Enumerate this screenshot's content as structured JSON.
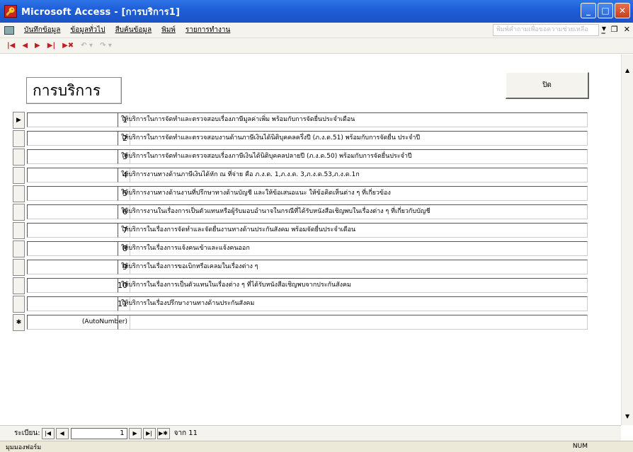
{
  "window": {
    "title": "Microsoft Access - [การบริการ1]",
    "app_icon": "access-key-icon"
  },
  "menu": {
    "items": [
      "บันทึกข้อมูล",
      "ข้อมูลทั่วไป",
      "สืบค้นข้อมูล",
      "พิมพ์",
      "รายการทำงาน"
    ],
    "help_placeholder": "พิมพ์คำถามเพื่อขอความช่วยเหลือ"
  },
  "toolbar": {
    "buttons": [
      "first-record",
      "previous-record",
      "next-record",
      "last-record",
      "delete-record",
      "undo",
      "redo"
    ],
    "glyphs": [
      "|◀",
      "◀",
      "▶",
      "▶|",
      "▶✖",
      "↶ ▾",
      "↷ ▾"
    ]
  },
  "form": {
    "title": "การบริการ",
    "close_button": "ปิด",
    "records": [
      {
        "id": "1",
        "description": "ให้บริการในการจัดทำและตรวจสอบเรื่องภาษีมูลค่าเพิ่ม พร้อมกับการจัดยื่นประจำเดือน"
      },
      {
        "id": "2",
        "description": "ให้บริการในการจัดทำและตรวจสอบงานด้านภาษีเงินได้นิติบุคคลครึ่งปี (ภ.ง.ด.51) พร้อมกับการจัดยื่น ประจำปี"
      },
      {
        "id": "3",
        "description": "ให้บริการในการจัดทำและตรวจสอบเรื่องภาษีเงินได้นิติบุคคลปลายปี (ภ.ง.ด.50) พร้อมกับการจัดยื่นประจำปี"
      },
      {
        "id": "4",
        "description": "ให้บริการงานทางด้านภาษีเงินได้หัก ณ ที่จ่าย คือ ภ.ง.ด. 1,ภ.ง.ด. 3,ภ.ง.ด.53,ภ.ง.ด.1ก"
      },
      {
        "id": "5",
        "description": "ให้บริการงานทางด้านงานที่ปรึกษาทางด้านบัญชี และให้ข้อเสนอแนะ ให้ข้อคิดเห็นต่าง ๆ ที่เกี่ยวข้อง"
      },
      {
        "id": "6",
        "description": "ให้บริการงานในเรื่องการเป็นตัวแทนหรือผู้รับมอบอำนาจในกรณีที่ได้รับหนังสือเชิญพบในเรื่องต่าง ๆ ที่เกี่ยวกับบัญชี"
      },
      {
        "id": "7",
        "description": "ให้บริการในเรื่องการจัดทำและจัดยื่นงานทางด้านประกันสังคม พร้อมจัดยื่นประจำเดือน"
      },
      {
        "id": "8",
        "description": "ให้บริการในเรื่องการแจ้งคนเข้าและแจ้งคนออก"
      },
      {
        "id": "9",
        "description": "ให้บริการในเรื่องการขอเบิกหรือเคลมในเรื่องต่าง ๆ"
      },
      {
        "id": "10",
        "description": "ให้บริการในเรื่องการเป็นตัวแทนในเรื่องต่าง ๆ ที่ได้รับหนังสือเชิญพบจากประกันสังคม"
      },
      {
        "id": "11",
        "description": "ให้บริการในเรื่องปรึกษางานทางด้านประกันสังคม"
      }
    ],
    "new_record_placeholder": "(AutoNumber)",
    "current_marker": "▶",
    "new_marker": "✱"
  },
  "navigation": {
    "label": "ระเบียน:",
    "current": "1",
    "of_text": "จาก 11",
    "buttons": [
      "|◀",
      "◀",
      "▶",
      "▶|",
      "▶✱"
    ]
  },
  "status": {
    "text": "มุมมองฟอร์ม",
    "num": "NUM"
  }
}
